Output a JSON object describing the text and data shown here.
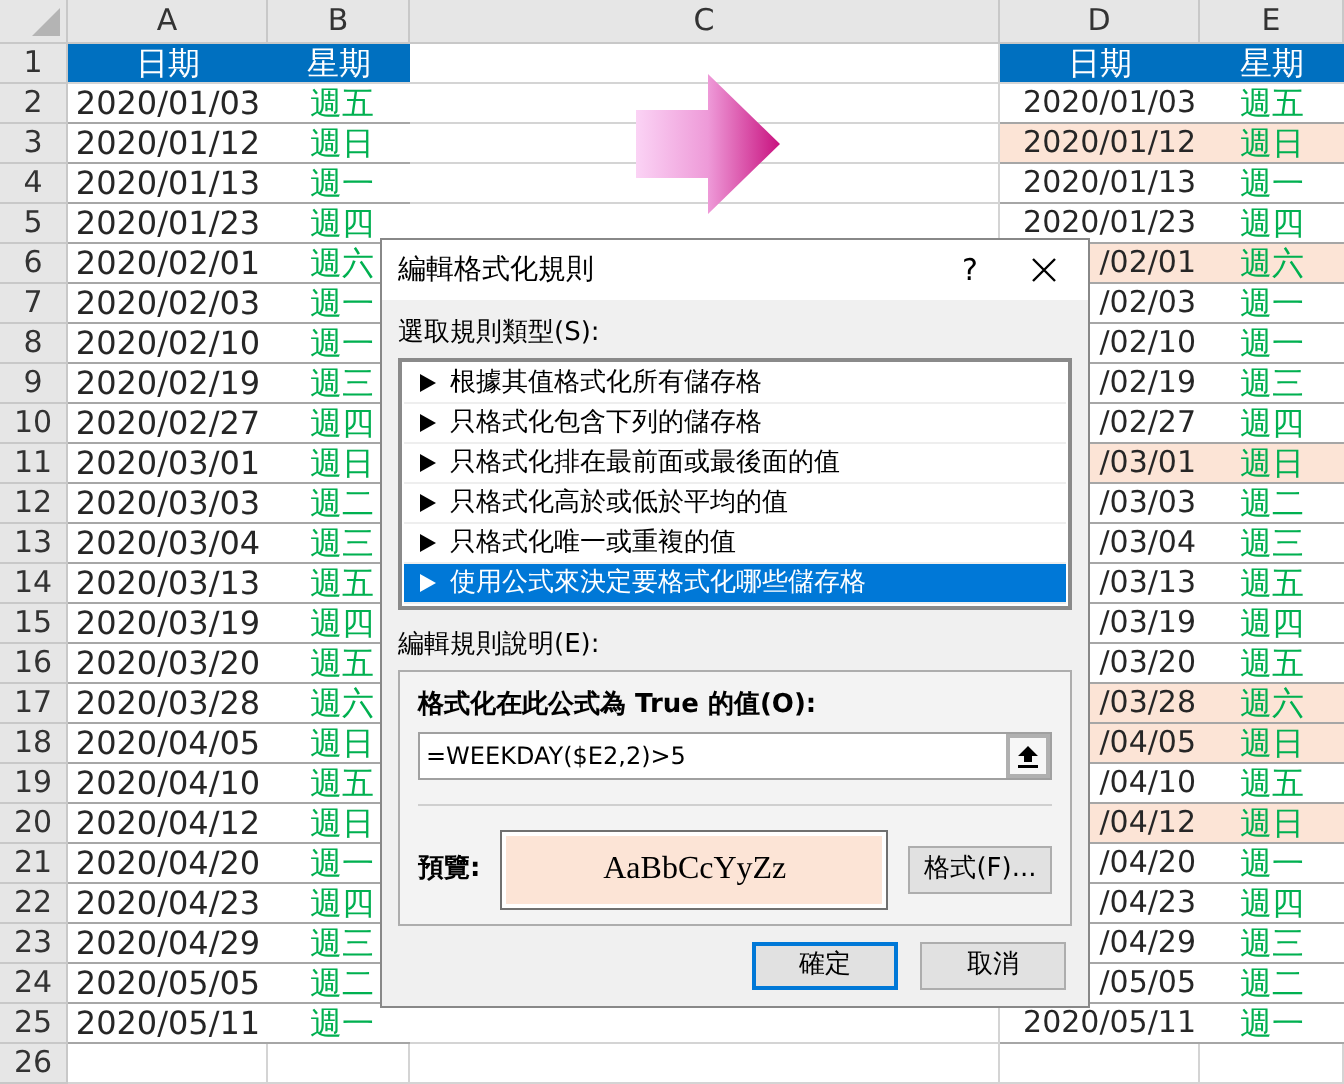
{
  "sheet": {
    "columns": [
      "A",
      "B",
      "C",
      "D",
      "E"
    ],
    "row_numbers": [
      "1",
      "2",
      "3",
      "4",
      "5",
      "6",
      "7",
      "8",
      "9",
      "10",
      "11",
      "12",
      "13",
      "14",
      "15",
      "16",
      "17",
      "18",
      "19",
      "20",
      "21",
      "22",
      "23",
      "24",
      "25",
      "26"
    ],
    "left_table": {
      "header": [
        "日期",
        "星期"
      ],
      "rows": [
        {
          "date": "2020/01/03",
          "weekday": "週五"
        },
        {
          "date": "2020/01/12",
          "weekday": "週日"
        },
        {
          "date": "2020/01/13",
          "weekday": "週一"
        },
        {
          "date": "2020/01/23",
          "weekday": "週四"
        },
        {
          "date": "2020/02/01",
          "weekday": "週六"
        },
        {
          "date": "2020/02/03",
          "weekday": "週一"
        },
        {
          "date": "2020/02/10",
          "weekday": "週一"
        },
        {
          "date": "2020/02/19",
          "weekday": "週三"
        },
        {
          "date": "2020/02/27",
          "weekday": "週四"
        },
        {
          "date": "2020/03/01",
          "weekday": "週日"
        },
        {
          "date": "2020/03/03",
          "weekday": "週二"
        },
        {
          "date": "2020/03/04",
          "weekday": "週三"
        },
        {
          "date": "2020/03/13",
          "weekday": "週五"
        },
        {
          "date": "2020/03/19",
          "weekday": "週四"
        },
        {
          "date": "2020/03/20",
          "weekday": "週五"
        },
        {
          "date": "2020/03/28",
          "weekday": "週六"
        },
        {
          "date": "2020/04/05",
          "weekday": "週日"
        },
        {
          "date": "2020/04/10",
          "weekday": "週五"
        },
        {
          "date": "2020/04/12",
          "weekday": "週日"
        },
        {
          "date": "2020/04/20",
          "weekday": "週一"
        },
        {
          "date": "2020/04/23",
          "weekday": "週四"
        },
        {
          "date": "2020/04/29",
          "weekday": "週三"
        },
        {
          "date": "2020/05/05",
          "weekday": "週二"
        },
        {
          "date": "2020/05/11",
          "weekday": "週一"
        }
      ]
    },
    "right_table": {
      "header": [
        "日期",
        "星期"
      ],
      "rows": [
        {
          "date": "2020/01/03",
          "weekday": "週五",
          "highlighted": false
        },
        {
          "date": "2020/01/12",
          "weekday": "週日",
          "highlighted": true
        },
        {
          "date": "2020/01/13",
          "weekday": "週一",
          "highlighted": false
        },
        {
          "date": "2020/01/23",
          "weekday": "週四",
          "highlighted": false
        },
        {
          "date": "/02/01",
          "weekday": "週六",
          "highlighted": true
        },
        {
          "date": "/02/03",
          "weekday": "週一",
          "highlighted": false
        },
        {
          "date": "/02/10",
          "weekday": "週一",
          "highlighted": false
        },
        {
          "date": "/02/19",
          "weekday": "週三",
          "highlighted": false
        },
        {
          "date": "/02/27",
          "weekday": "週四",
          "highlighted": false
        },
        {
          "date": "/03/01",
          "weekday": "週日",
          "highlighted": true
        },
        {
          "date": "/03/03",
          "weekday": "週二",
          "highlighted": false
        },
        {
          "date": "/03/04",
          "weekday": "週三",
          "highlighted": false
        },
        {
          "date": "/03/13",
          "weekday": "週五",
          "highlighted": false
        },
        {
          "date": "/03/19",
          "weekday": "週四",
          "highlighted": false
        },
        {
          "date": "/03/20",
          "weekday": "週五",
          "highlighted": false
        },
        {
          "date": "/03/28",
          "weekday": "週六",
          "highlighted": true
        },
        {
          "date": "/04/05",
          "weekday": "週日",
          "highlighted": true
        },
        {
          "date": "/04/10",
          "weekday": "週五",
          "highlighted": false
        },
        {
          "date": "/04/12",
          "weekday": "週日",
          "highlighted": true
        },
        {
          "date": "/04/20",
          "weekday": "週一",
          "highlighted": false
        },
        {
          "date": "/04/23",
          "weekday": "週四",
          "highlighted": false
        },
        {
          "date": "/04/29",
          "weekday": "週三",
          "highlighted": false
        },
        {
          "date": "/05/05",
          "weekday": "週二",
          "highlighted": false
        },
        {
          "date": "2020/05/11",
          "weekday": "週一",
          "highlighted": false
        }
      ]
    }
  },
  "dialog": {
    "title": "編輯格式化規則",
    "help": "?",
    "rule_type_label": "選取規則類型(S):",
    "rule_types": [
      {
        "label": "根據其值格式化所有儲存格",
        "selected": false
      },
      {
        "label": "只格式化包含下列的儲存格",
        "selected": false
      },
      {
        "label": "只格式化排在最前面或最後面的值",
        "selected": false
      },
      {
        "label": "只格式化高於或低於平均的值",
        "selected": false
      },
      {
        "label": "只格式化唯一或重複的值",
        "selected": false
      },
      {
        "label": "使用公式來決定要格式化哪些儲存格",
        "selected": true
      }
    ],
    "description_label": "編輯規則說明(E):",
    "formula_label": "格式化在此公式為 True 的值(O):",
    "formula": "=WEEKDAY($E2,2)>5",
    "preview_label": "預覽:",
    "preview_text": "AaBbCcYyZz",
    "format_button": "格式(F)...",
    "ok_button": "確定",
    "cancel_button": "取消"
  }
}
